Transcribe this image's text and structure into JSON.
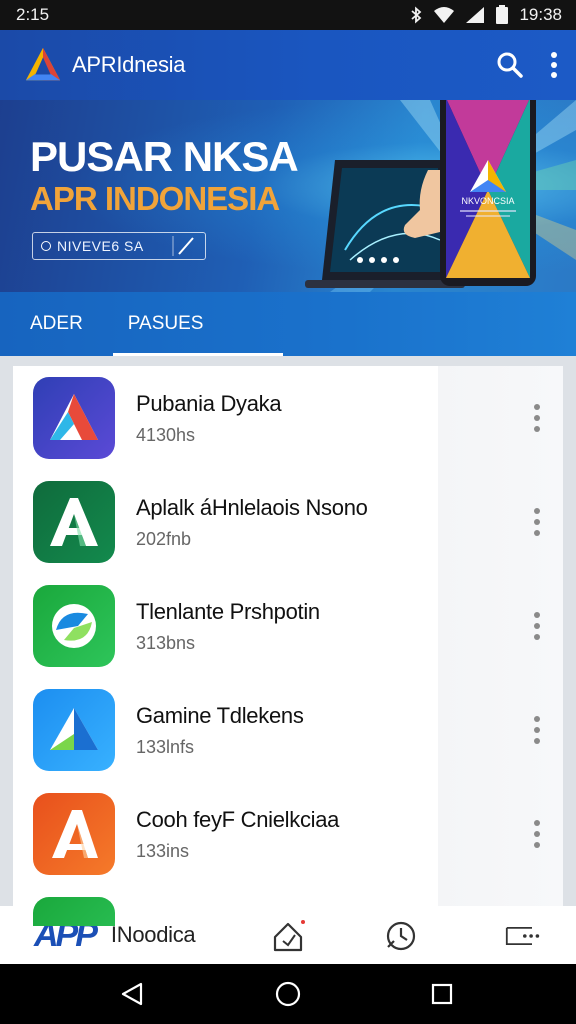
{
  "status_bar": {
    "time_left": "2:15",
    "time_right": "19:38",
    "icons": [
      "bluetooth-icon",
      "wifi-icon",
      "signal-icon",
      "battery-icon"
    ]
  },
  "app_bar": {
    "title": "APRIdnesia",
    "actions": [
      "search-icon",
      "more-vertical-icon"
    ]
  },
  "banner": {
    "title_line1": "PUSAR NKSA",
    "title_line2": "APR INDONESIA",
    "chip_text": "NIVEVE6 SA",
    "phone_text_1": "NKVONCSIA",
    "accent_orange": "#f1a43a"
  },
  "tabs": [
    {
      "label": "ADER",
      "active": false
    },
    {
      "label": "PASUES",
      "active": true
    }
  ],
  "apps": [
    {
      "name": "Pubania Dyaka",
      "size": "4130hs",
      "icon_colors": [
        "#2f3fb5",
        "#5b4ad6"
      ],
      "glyph_colors": [
        "#ffffff",
        "#e84a3a",
        "#2fb7e8"
      ]
    },
    {
      "name": "Aplalk áHnlelaois Nsono",
      "size": "202fnb",
      "icon_colors": [
        "#0f6b3c",
        "#138a4d"
      ],
      "glyph_colors": [
        "#ffffff",
        "#16a35a",
        "#7fe0a8"
      ]
    },
    {
      "name": "Tlenlante Prshpotin",
      "size": "313bns",
      "icon_colors": [
        "#1aa83c",
        "#2ec55a"
      ],
      "glyph_colors": [
        "#ffffff",
        "#1a8ae0",
        "#8fe060"
      ]
    },
    {
      "name": "Gamine Tdlekens",
      "size": "133lnfs",
      "icon_colors": [
        "#1c8ef0",
        "#38b1ff"
      ],
      "glyph_colors": [
        "#ffffff",
        "#1b6fd1",
        "#7ad64a"
      ]
    },
    {
      "name": "Cooh feyF Cnielkciaa",
      "size": "133ins",
      "icon_colors": [
        "#e8501c",
        "#f57a2a"
      ],
      "glyph_colors": [
        "#ffffff",
        "#e0401a",
        "#ffd0a0"
      ]
    }
  ],
  "bottom_nav": {
    "brand_logo": "APP",
    "brand_label": "INoodica",
    "items": [
      "home-icon",
      "history-icon",
      "more-horizontal-icon"
    ]
  },
  "system_nav": [
    "back-icon",
    "home-circle-icon",
    "recents-icon"
  ]
}
